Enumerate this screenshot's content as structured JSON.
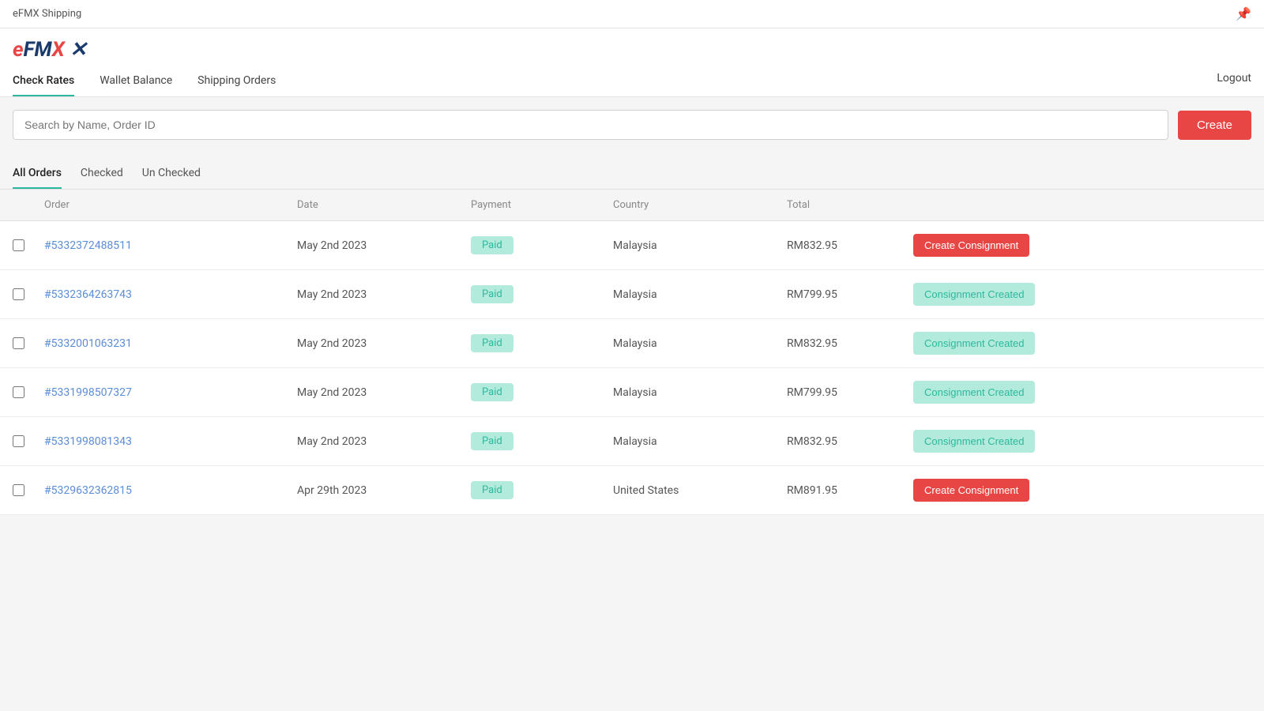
{
  "topBar": {
    "title": "eFMX Shipping",
    "pinIcon": "📌"
  },
  "logo": {
    "text": "eFMX"
  },
  "nav": {
    "tabs": [
      {
        "id": "check-rates",
        "label": "Check Rates",
        "active": true
      },
      {
        "id": "wallet-balance",
        "label": "Wallet Balance",
        "active": false
      },
      {
        "id": "shipping-orders",
        "label": "Shipping Orders",
        "active": false
      }
    ],
    "logoutLabel": "Logout"
  },
  "searchBar": {
    "placeholder": "Search by Name, Order ID",
    "createLabel": "Create"
  },
  "filterTabs": [
    {
      "id": "all-orders",
      "label": "All Orders",
      "active": true
    },
    {
      "id": "checked",
      "label": "Checked",
      "active": false
    },
    {
      "id": "un-checked",
      "label": "Un Checked",
      "active": false
    }
  ],
  "tableHeaders": {
    "order": "Order",
    "date": "Date",
    "payment": "Payment",
    "country": "Country",
    "total": "Total",
    "action": ""
  },
  "orders": [
    {
      "id": "row-1",
      "orderNumber": "#5332372488511",
      "date": "May 2nd 2023",
      "payment": "Paid",
      "country": "Malaysia",
      "total": "RM832.95",
      "actionType": "create",
      "actionLabel": "Create Consignment",
      "checked": false
    },
    {
      "id": "row-2",
      "orderNumber": "#5332364263743",
      "date": "May 2nd 2023",
      "payment": "Paid",
      "country": "Malaysia",
      "total": "RM799.95",
      "actionType": "created",
      "actionLabel": "Consignment Created",
      "checked": false
    },
    {
      "id": "row-3",
      "orderNumber": "#5332001063231",
      "date": "May 2nd 2023",
      "payment": "Paid",
      "country": "Malaysia",
      "total": "RM832.95",
      "actionType": "created",
      "actionLabel": "Consignment Created",
      "checked": false
    },
    {
      "id": "row-4",
      "orderNumber": "#5331998507327",
      "date": "May 2nd 2023",
      "payment": "Paid",
      "country": "Malaysia",
      "total": "RM799.95",
      "actionType": "created",
      "actionLabel": "Consignment Created",
      "checked": false
    },
    {
      "id": "row-5",
      "orderNumber": "#5331998081343",
      "date": "May 2nd 2023",
      "payment": "Paid",
      "country": "Malaysia",
      "total": "RM832.95",
      "actionType": "created",
      "actionLabel": "Consignment Created",
      "checked": false
    },
    {
      "id": "row-6",
      "orderNumber": "#5329632362815",
      "date": "Apr 29th 2023",
      "payment": "Paid",
      "country": "United States",
      "total": "RM891.95",
      "actionType": "create",
      "actionLabel": "Create Consignment",
      "checked": false
    }
  ]
}
